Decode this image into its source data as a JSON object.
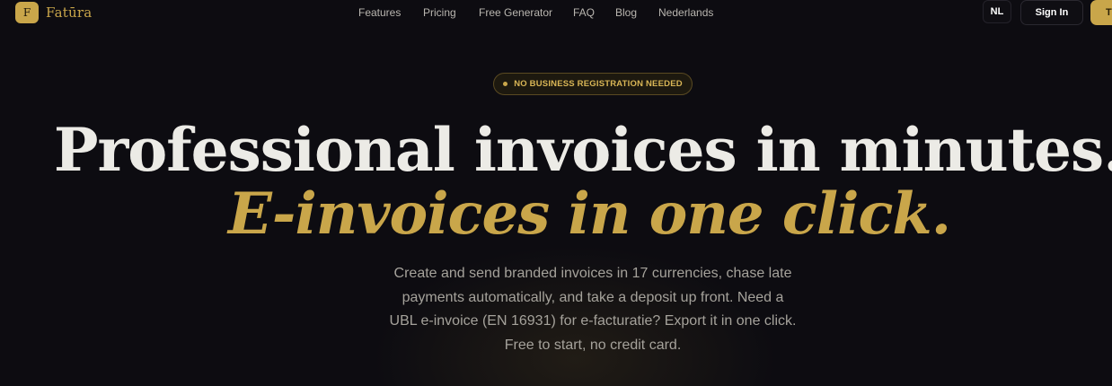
{
  "brand": {
    "logo_letter": "F",
    "name": "Fatūra",
    "accent_color": "#c9a64a",
    "background_color": "#0d0c11"
  },
  "nav": {
    "items": [
      {
        "label": "Features"
      },
      {
        "label": "Pricing"
      },
      {
        "label": "Free Generator"
      },
      {
        "label": "FAQ"
      },
      {
        "label": "Blog"
      },
      {
        "label": "Nederlands"
      }
    ]
  },
  "header_actions": {
    "language_label": "NL",
    "sign_in_label": "Sign In",
    "cta_label_visible": "T"
  },
  "hero": {
    "badge": "NO BUSINESS REGISTRATION NEEDED",
    "headline": "Professional invoices in minutes.",
    "headline_accent": "E-invoices in one click.",
    "subtitle": "Create and send branded invoices in 17 currencies, chase late payments automatically, and take a deposit up front. Need a UBL e-invoice (EN 16931) for e-facturatie? Export it in one click. Free to start, no credit card."
  }
}
